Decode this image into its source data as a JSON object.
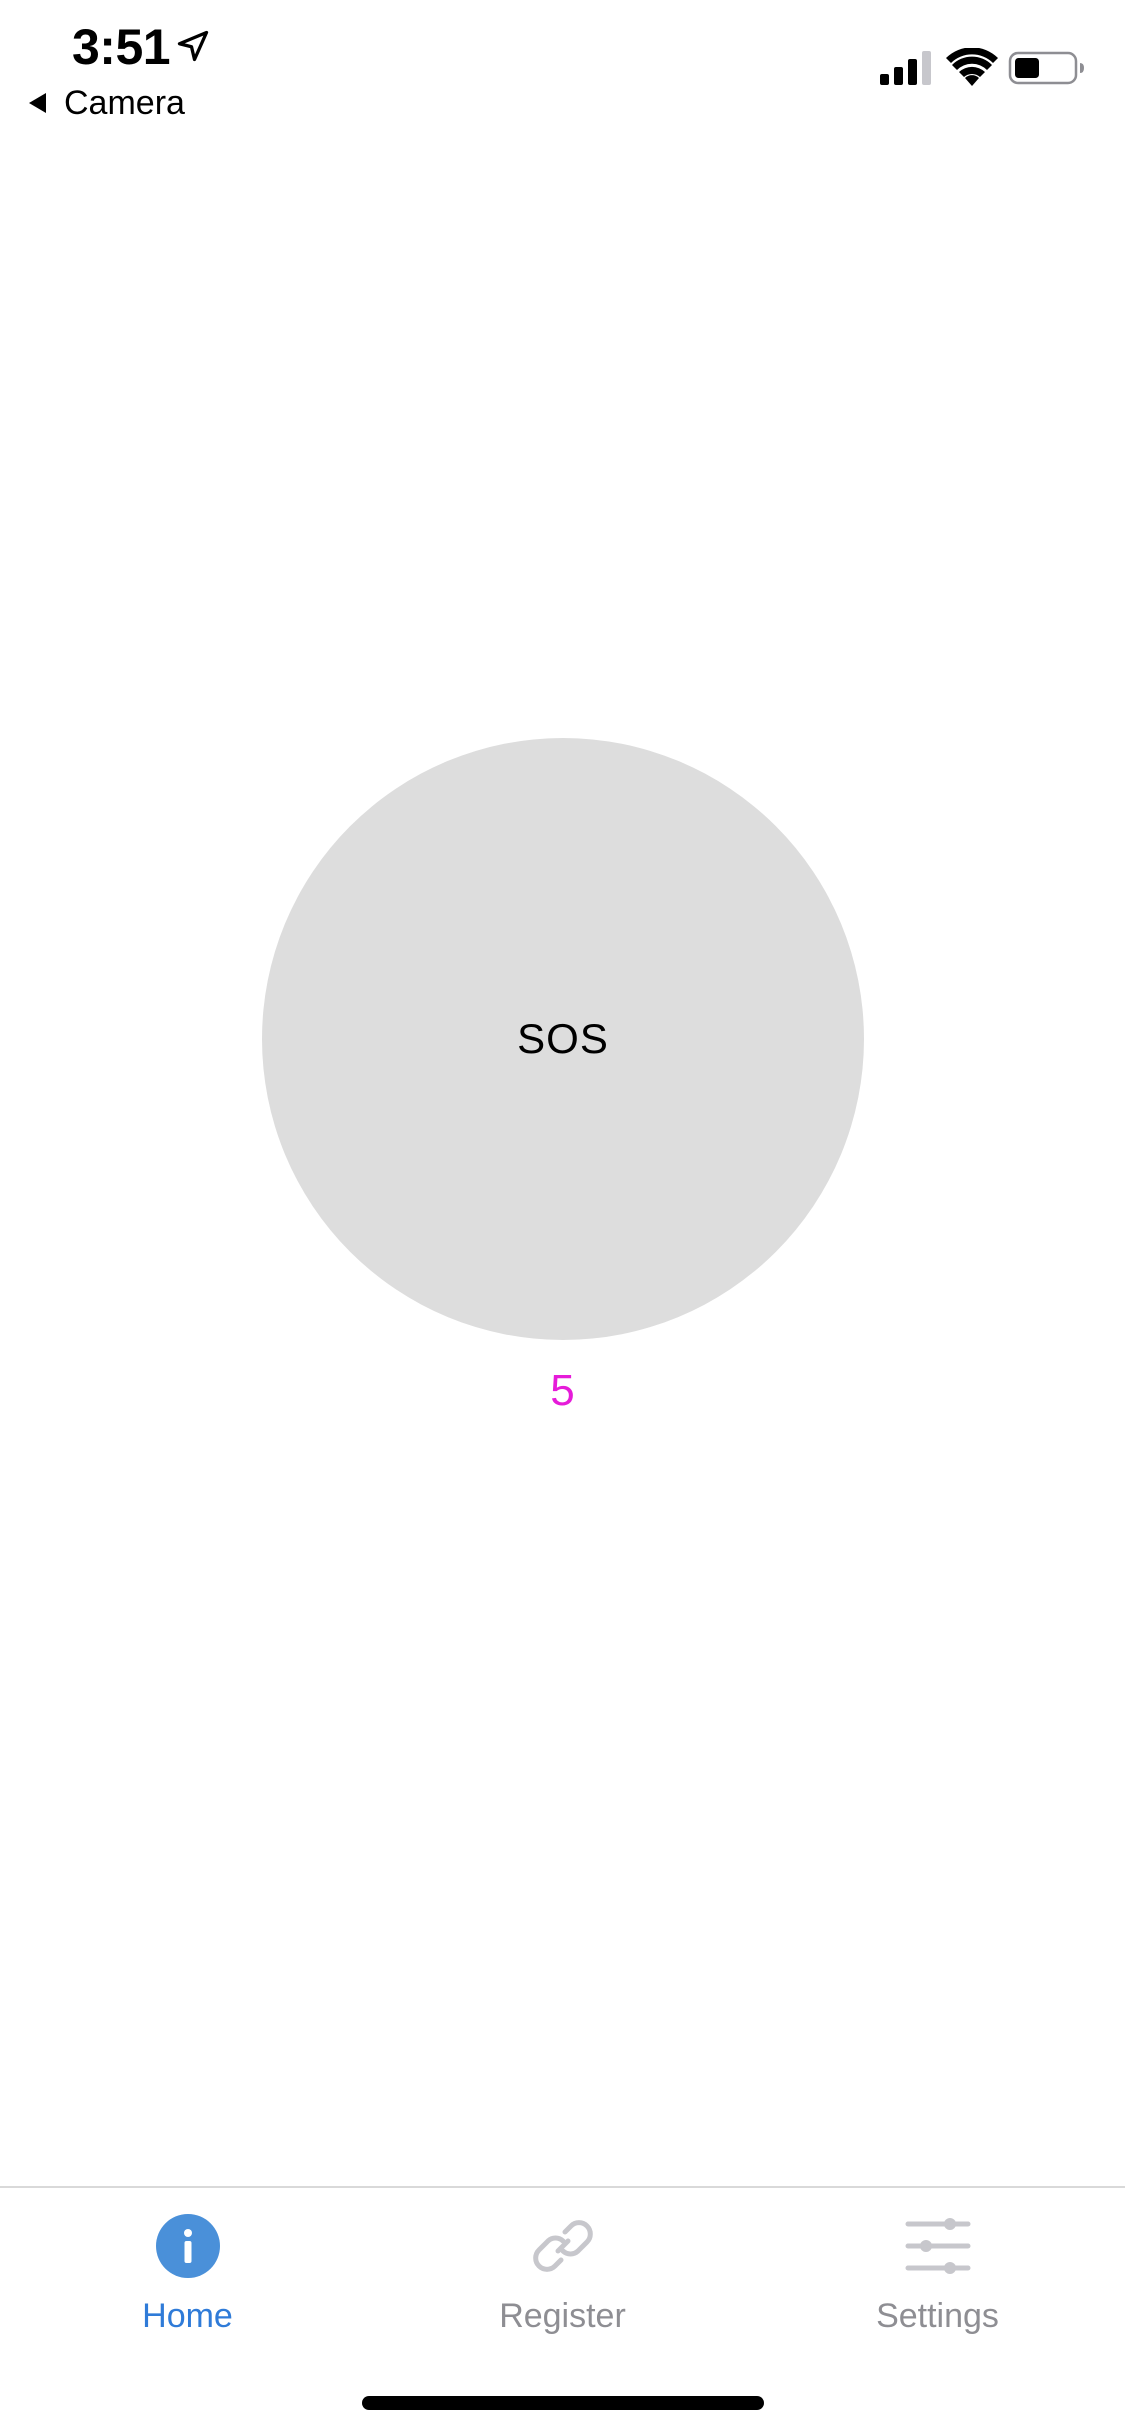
{
  "status_bar": {
    "time": "3:51",
    "back_label": "Camera",
    "icons": [
      "location-arrow-icon",
      "cellular-signal-icon",
      "wifi-icon",
      "battery-icon"
    ]
  },
  "main": {
    "sos_label": "SOS",
    "countdown": "5",
    "countdown_color": "#e61bd9",
    "button_color": "#dddddd"
  },
  "tabbar": {
    "tabs": [
      {
        "label": "Home",
        "icon": "info-icon",
        "active": true
      },
      {
        "label": "Register",
        "icon": "link-icon",
        "active": false
      },
      {
        "label": "Settings",
        "icon": "sliders-icon",
        "active": false
      }
    ],
    "active_color": "#2f7bd8",
    "inactive_color": "#8e8e93"
  }
}
